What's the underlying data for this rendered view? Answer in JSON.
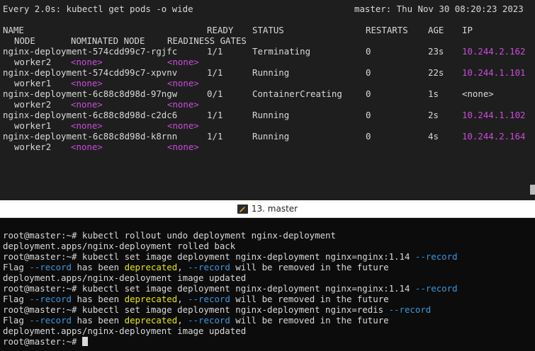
{
  "watch": {
    "header_left": "Every 2.0s: kubectl get pods -o wide",
    "header_right": "master: Thu Nov 30 08:20:23 2023",
    "columns": {
      "name": "NAME",
      "ready": "READY",
      "status": "STATUS",
      "restarts": "RESTARTS",
      "age": "AGE",
      "ip": "IP",
      "node": "NODE",
      "nominated": "NOMINATED NODE",
      "gates": "READINESS GATES"
    },
    "pods": [
      {
        "name": "nginx-deployment-574cdd99c7-rgjfc",
        "ready": "1/1",
        "status": "Terminating",
        "restarts": "0",
        "age": "23s",
        "ip": "10.244.2.162",
        "node": "worker2",
        "nominated": "<none>",
        "gates": "<none>"
      },
      {
        "name": "nginx-deployment-574cdd99c7-xpvnv",
        "ready": "1/1",
        "status": "Running",
        "restarts": "0",
        "age": "22s",
        "ip": "10.244.1.101",
        "node": "worker1",
        "nominated": "<none>",
        "gates": "<none>"
      },
      {
        "name": "nginx-deployment-6c88c8d98d-97ngw",
        "ready": "0/1",
        "status": "ContainerCreating",
        "restarts": "0",
        "age": "1s",
        "ip": "<none>",
        "node": "worker2",
        "nominated": "<none>",
        "gates": "<none>"
      },
      {
        "name": "nginx-deployment-6c88c8d98d-c2dc6",
        "ready": "1/1",
        "status": "Running",
        "restarts": "0",
        "age": "2s",
        "ip": "10.244.1.102",
        "node": "worker1",
        "nominated": "<none>",
        "gates": "<none>"
      },
      {
        "name": "nginx-deployment-6c88c8d98d-k8rnn",
        "ready": "1/1",
        "status": "Running",
        "restarts": "0",
        "age": "4s",
        "ip": "10.244.2.164",
        "node": "worker2",
        "nominated": "<none>",
        "gates": "<none>"
      }
    ]
  },
  "titlebar": {
    "title": "13. master"
  },
  "shell": {
    "prompt": "root@master:~#",
    "lines": [
      {
        "type": "cmd",
        "text": " kubectl rollout undo deployment nginx-deployment"
      },
      {
        "type": "out",
        "text": "deployment.apps/nginx-deployment rolled back"
      },
      {
        "type": "cmd",
        "text": " kubectl set image deployment nginx-deployment nginx=nginx:1.14 ",
        "flag": "--record"
      },
      {
        "type": "warn",
        "a": "Flag ",
        "b": "--record",
        "c": " has been ",
        "d": "deprecated",
        "e": ", ",
        "f": "--record",
        "g": " will be removed in the future"
      },
      {
        "type": "out",
        "text": "deployment.apps/nginx-deployment image updated"
      },
      {
        "type": "cmd",
        "text": " kubectl set image deployment nginx-deployment nginx=nginx:1.14 ",
        "flag": "--record"
      },
      {
        "type": "warn",
        "a": "Flag ",
        "b": "--record",
        "c": " has been ",
        "d": "deprecated",
        "e": ", ",
        "f": "--record",
        "g": " will be removed in the future"
      },
      {
        "type": "cmd",
        "text": " kubectl set image deployment nginx-deployment nginx=redis ",
        "flag": "--record"
      },
      {
        "type": "warn",
        "a": "Flag ",
        "b": "--record",
        "c": " has been ",
        "d": "deprecated",
        "e": ", ",
        "f": "--record",
        "g": " will be removed in the future"
      },
      {
        "type": "out",
        "text": "deployment.apps/nginx-deployment image updated"
      }
    ]
  },
  "colors": {
    "ip": "#c94dd9",
    "flag": "#3a96dd",
    "deprecated": "#e5e510"
  }
}
